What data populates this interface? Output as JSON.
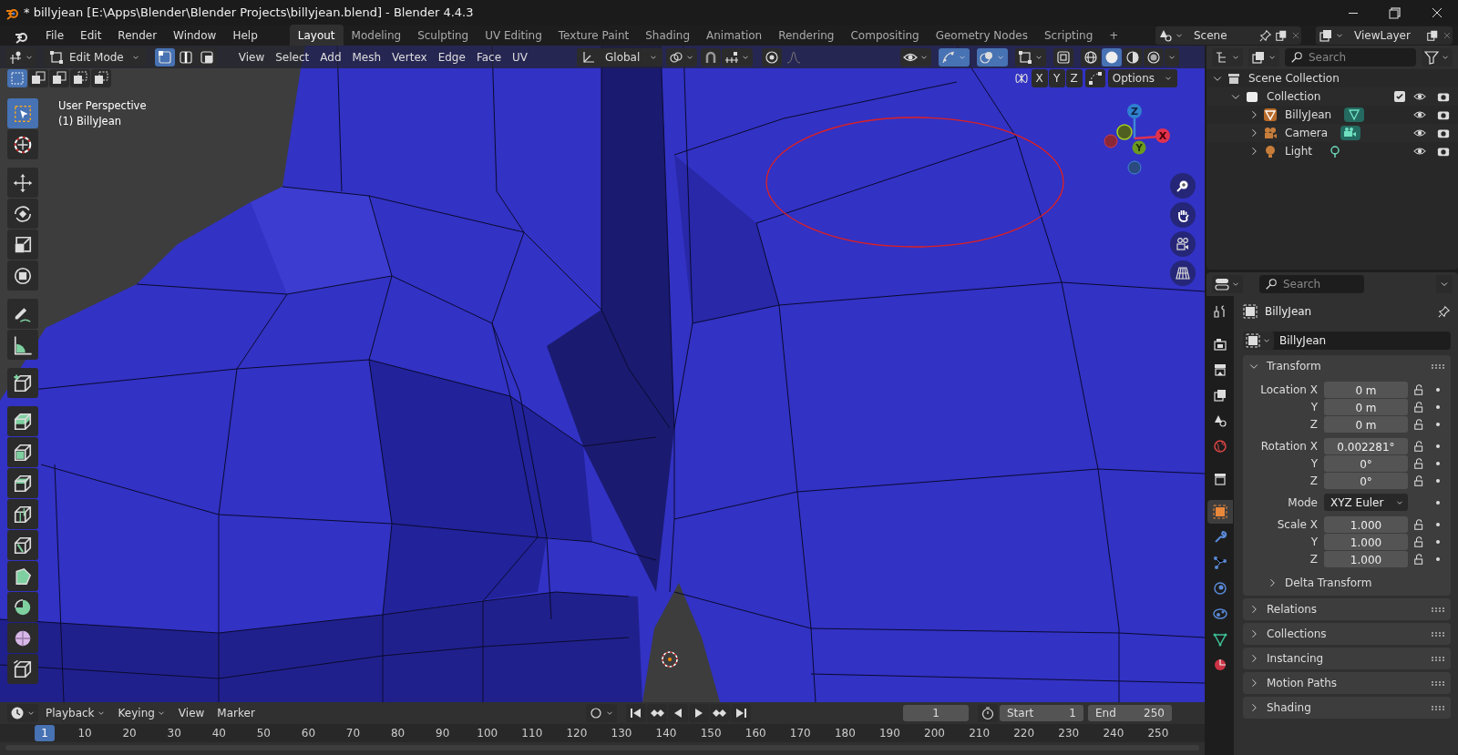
{
  "window": {
    "title": "* billyjean [E:\\Apps\\Blender\\Blender Projects\\billyjean.blend] - Blender 4.4.3"
  },
  "menu": [
    "File",
    "Edit",
    "Render",
    "Window",
    "Help"
  ],
  "workspaces": [
    {
      "label": "Layout",
      "selected": true
    },
    {
      "label": "Modeling",
      "selected": false
    },
    {
      "label": "Sculpting",
      "selected": false
    },
    {
      "label": "UV Editing",
      "selected": false
    },
    {
      "label": "Texture Paint",
      "selected": false
    },
    {
      "label": "Shading",
      "selected": false
    },
    {
      "label": "Animation",
      "selected": false
    },
    {
      "label": "Rendering",
      "selected": false
    },
    {
      "label": "Compositing",
      "selected": false
    },
    {
      "label": "Geometry Nodes",
      "selected": false
    },
    {
      "label": "Scripting",
      "selected": false
    }
  ],
  "add_workspace": "+",
  "scene": {
    "value": "Scene"
  },
  "view_layer": {
    "value": "ViewLayer"
  },
  "viewport": {
    "mode": "Edit Mode",
    "select_modes": [
      {
        "kind": "vertex",
        "selected": true
      },
      {
        "kind": "edge",
        "selected": false
      },
      {
        "kind": "face",
        "selected": false
      }
    ],
    "menus": [
      "View",
      "Select",
      "Add",
      "Mesh",
      "Vertex",
      "Edge",
      "Face",
      "UV"
    ],
    "orientation": "Global",
    "toggles": [
      {
        "kind": "visibility",
        "on": false
      },
      {
        "kind": "gizmos",
        "on": true
      },
      {
        "kind": "overlays",
        "on": true
      },
      {
        "kind": "mesh-overlays",
        "on": false
      },
      {
        "kind": "xray",
        "on": false
      }
    ],
    "shading": [
      {
        "kind": "wireframe",
        "selected": false
      },
      {
        "kind": "solid",
        "selected": true
      },
      {
        "kind": "material",
        "selected": false
      },
      {
        "kind": "rendered",
        "selected": false
      }
    ],
    "box_modes": [
      {
        "selected": true
      },
      {
        "selected": false
      },
      {
        "selected": false
      },
      {
        "selected": false
      },
      {
        "selected": false
      }
    ],
    "mirror_axes": [
      {
        "label": "X",
        "on": false
      },
      {
        "label": "Y",
        "on": false
      },
      {
        "label": "Z",
        "on": false
      }
    ],
    "options": "Options",
    "info": [
      "User Perspective",
      "(1) BillyJean"
    ],
    "gizmo_axes": [
      "Z",
      "X",
      "Y"
    ],
    "tools": [
      {
        "kind": "select",
        "selected": true
      },
      {
        "kind": "cursor",
        "selected": false
      },
      {
        "kind": "move",
        "selected": false
      },
      {
        "kind": "rotate",
        "selected": false
      },
      {
        "kind": "scale",
        "selected": false
      },
      {
        "kind": "transform",
        "selected": false
      },
      {
        "kind": "annotate",
        "selected": false
      },
      {
        "kind": "measure",
        "selected": false
      },
      {
        "kind": "add-cube",
        "selected": false
      },
      {
        "kind": "extrude",
        "selected": false
      },
      {
        "kind": "inset",
        "selected": false
      },
      {
        "kind": "bevel",
        "selected": false
      },
      {
        "kind": "loop-cut",
        "selected": false
      },
      {
        "kind": "knife",
        "selected": false
      },
      {
        "kind": "poly-build",
        "selected": false
      },
      {
        "kind": "spin",
        "selected": false
      },
      {
        "kind": "smooth",
        "selected": false
      },
      {
        "kind": "shear",
        "selected": false
      }
    ]
  },
  "outliner": {
    "search": {
      "placeholder": "Search"
    },
    "items": [
      {
        "label": "Scene Collection",
        "kind": "scene",
        "expanded": true,
        "children": [
          {
            "label": "Collection",
            "kind": "collection",
            "expanded": true,
            "checked": true,
            "children": [
              {
                "label": "BillyJean",
                "kind": "mesh",
                "expanded": false
              },
              {
                "label": "Camera",
                "kind": "camera",
                "expanded": false
              },
              {
                "label": "Light",
                "kind": "light",
                "expanded": false
              }
            ]
          }
        ]
      }
    ]
  },
  "properties": {
    "search": {
      "placeholder": "Search"
    },
    "tabs": [
      {
        "kind": "tool",
        "selected": false
      },
      {
        "kind": "render",
        "selected": false
      },
      {
        "kind": "output",
        "selected": false
      },
      {
        "kind": "view-layer",
        "selected": false
      },
      {
        "kind": "scene",
        "selected": false
      },
      {
        "kind": "world",
        "selected": false
      },
      {
        "kind": "collection",
        "selected": false
      },
      {
        "kind": "object",
        "selected": true
      },
      {
        "kind": "modifiers",
        "selected": false
      },
      {
        "kind": "particles",
        "selected": false
      },
      {
        "kind": "physics",
        "selected": false
      },
      {
        "kind": "constraints",
        "selected": false
      },
      {
        "kind": "data",
        "selected": false
      },
      {
        "kind": "material",
        "selected": false
      }
    ],
    "object_name": "BillyJean",
    "name_field": "BillyJean",
    "panels": [
      {
        "title": "Transform",
        "expanded": true,
        "groups": [
          [
            {
              "label": "Location X",
              "value": "0 m",
              "kind": "number"
            },
            {
              "label": "Y",
              "value": "0 m",
              "kind": "number"
            },
            {
              "label": "Z",
              "value": "0 m",
              "kind": "number"
            }
          ],
          [
            {
              "label": "Rotation X",
              "value": "0.002281°",
              "kind": "number"
            },
            {
              "label": "Y",
              "value": "0°",
              "kind": "number"
            },
            {
              "label": "Z",
              "value": "0°",
              "kind": "number"
            }
          ],
          [
            {
              "label": "Mode",
              "value": "XYZ Euler",
              "kind": "dropdown"
            }
          ],
          [
            {
              "label": "Scale X",
              "value": "1.000",
              "kind": "number"
            },
            {
              "label": "Y",
              "value": "1.000",
              "kind": "number"
            },
            {
              "label": "Z",
              "value": "1.000",
              "kind": "number"
            }
          ]
        ],
        "subpanels": [
          {
            "title": "Delta Transform",
            "expanded": false
          }
        ]
      },
      {
        "title": "Relations",
        "expanded": false
      },
      {
        "title": "Collections",
        "expanded": false
      },
      {
        "title": "Instancing",
        "expanded": false
      },
      {
        "title": "Motion Paths",
        "expanded": false
      },
      {
        "title": "Shading",
        "expanded": false
      }
    ]
  },
  "timeline": {
    "menus": [
      "Playback",
      "Keying",
      "View",
      "Marker"
    ],
    "current_frame": "1",
    "start_label": "Start",
    "start": "1",
    "end_label": "End",
    "end": "250",
    "ruler": [
      {
        "label": "1",
        "selected": true
      },
      {
        "label": "10",
        "selected": false
      },
      {
        "label": "20",
        "selected": false
      },
      {
        "label": "30",
        "selected": false
      },
      {
        "label": "40",
        "selected": false
      },
      {
        "label": "50",
        "selected": false
      },
      {
        "label": "60",
        "selected": false
      },
      {
        "label": "70",
        "selected": false
      },
      {
        "label": "80",
        "selected": false
      },
      {
        "label": "90",
        "selected": false
      },
      {
        "label": "100",
        "selected": false
      },
      {
        "label": "110",
        "selected": false
      },
      {
        "label": "120",
        "selected": false
      },
      {
        "label": "130",
        "selected": false
      },
      {
        "label": "140",
        "selected": false
      },
      {
        "label": "150",
        "selected": false
      },
      {
        "label": "160",
        "selected": false
      },
      {
        "label": "170",
        "selected": false
      },
      {
        "label": "180",
        "selected": false
      },
      {
        "label": "190",
        "selected": false
      },
      {
        "label": "200",
        "selected": false
      },
      {
        "label": "210",
        "selected": false
      },
      {
        "label": "220",
        "selected": false
      },
      {
        "label": "230",
        "selected": false
      },
      {
        "label": "240",
        "selected": false
      },
      {
        "label": "250",
        "selected": false
      }
    ]
  }
}
